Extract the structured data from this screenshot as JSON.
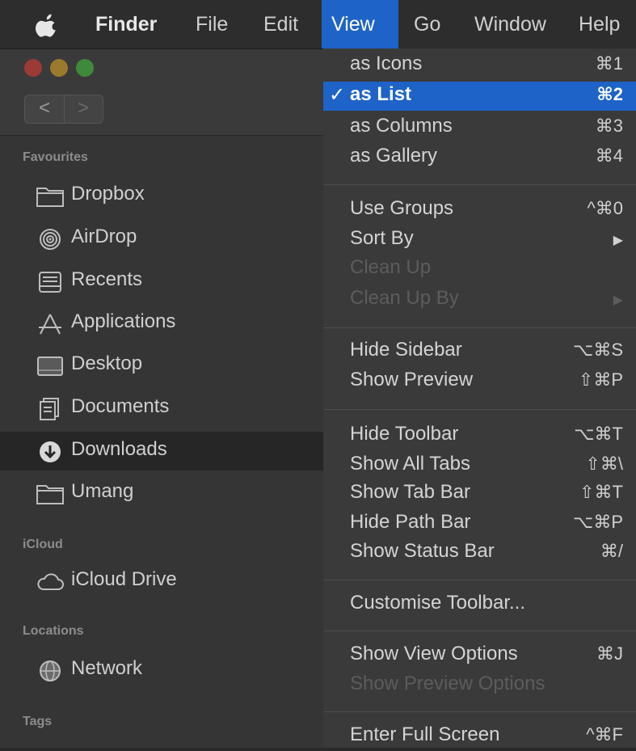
{
  "menubar": {
    "items": [
      {
        "label": "Finder"
      },
      {
        "label": "File"
      },
      {
        "label": "Edit"
      },
      {
        "label": "View"
      },
      {
        "label": "Go"
      },
      {
        "label": "Window"
      },
      {
        "label": "Help"
      }
    ]
  },
  "window": {
    "nav": {
      "back": "<",
      "forward": ">"
    }
  },
  "sidebar": {
    "favourites_title": "Favourites",
    "icloud_title": "iCloud",
    "locations_title": "Locations",
    "tags_title": "Tags",
    "items": [
      {
        "label": "Dropbox",
        "icon": "folder-icon"
      },
      {
        "label": "AirDrop",
        "icon": "airdrop-icon"
      },
      {
        "label": "Recents",
        "icon": "recents-icon"
      },
      {
        "label": "Applications",
        "icon": "applications-icon"
      },
      {
        "label": "Desktop",
        "icon": "desktop-icon"
      },
      {
        "label": "Documents",
        "icon": "documents-icon"
      },
      {
        "label": "Downloads",
        "icon": "downloads-icon"
      },
      {
        "label": "Umang",
        "icon": "folder-icon"
      },
      {
        "label": "iCloud Drive",
        "icon": "cloud-icon"
      },
      {
        "label": "Network",
        "icon": "globe-icon"
      }
    ]
  },
  "view_menu": {
    "items": [
      {
        "label": "as Icons",
        "shortcut": "⌘1"
      },
      {
        "label": "as List",
        "shortcut": "⌘2",
        "checked": "✓"
      },
      {
        "label": "as Columns",
        "shortcut": "⌘3"
      },
      {
        "label": "as Gallery",
        "shortcut": "⌘4"
      },
      {
        "label": "Use Groups",
        "shortcut": "^⌘0"
      },
      {
        "label": "Sort By",
        "shortcut": "▶"
      },
      {
        "label": "Clean Up",
        "shortcut": ""
      },
      {
        "label": "Clean Up By",
        "shortcut": "▶"
      },
      {
        "label": "Hide Sidebar",
        "shortcut": "⌥⌘S"
      },
      {
        "label": "Show Preview",
        "shortcut": "⇧⌘P"
      },
      {
        "label": "Hide Toolbar",
        "shortcut": "⌥⌘T"
      },
      {
        "label": "Show All Tabs",
        "shortcut": "⇧⌘\\"
      },
      {
        "label": "Show Tab Bar",
        "shortcut": "⇧⌘T"
      },
      {
        "label": "Hide Path Bar",
        "shortcut": "⌥⌘P"
      },
      {
        "label": "Show Status Bar",
        "shortcut": "⌘/"
      },
      {
        "label": "Customise Toolbar...",
        "shortcut": ""
      },
      {
        "label": "Show View Options",
        "shortcut": "⌘J"
      },
      {
        "label": "Show Preview Options",
        "shortcut": ""
      },
      {
        "label": "Enter Full Screen",
        "shortcut": "^⌘F"
      }
    ]
  },
  "colors": {
    "highlight": "#1e63c8",
    "menu_bg": "#3a3a3a",
    "sidebar_bg": "#353535"
  }
}
